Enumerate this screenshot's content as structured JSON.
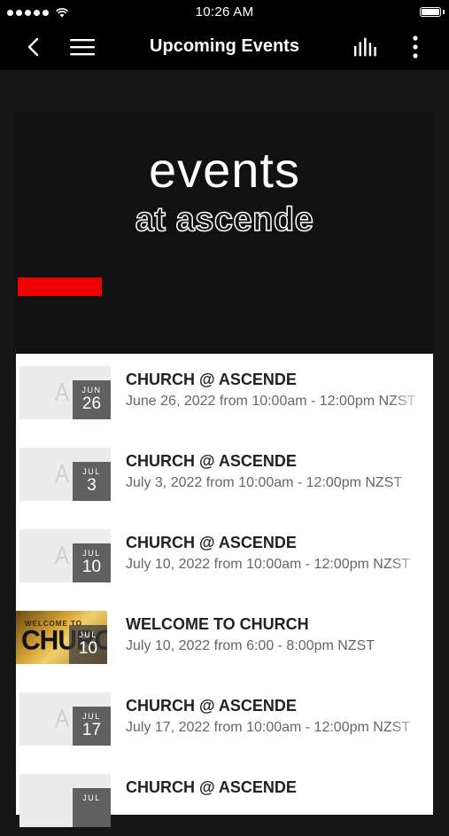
{
  "status": {
    "time": "10:26 AM",
    "signal_icon": "signal-dots-icon",
    "wifi_icon": "wifi-icon",
    "battery_icon": "battery-icon"
  },
  "nav": {
    "title": "Upcoming Events",
    "back_icon": "chevron-left-icon",
    "menu_icon": "hamburger-menu-icon",
    "stats_icon": "equalizer-icon",
    "more_icon": "vertical-dots-icon"
  },
  "banner": {
    "title": "events",
    "subtitle": "at ascende",
    "accent_color": "#f10000"
  },
  "events": [
    {
      "title": "CHURCH @ ASCENDE",
      "time": "June 26, 2022 from 10:00am - 12:00pm NZST",
      "month": "JUN",
      "day": "26",
      "thumb": "logo"
    },
    {
      "title": "CHURCH @ ASCENDE",
      "time": "July 3, 2022 from 10:00am - 12:00pm NZST",
      "month": "JUL",
      "day": "3",
      "thumb": "logo"
    },
    {
      "title": "CHURCH @ ASCENDE",
      "time": "July 10, 2022 from 10:00am - 12:00pm NZST",
      "month": "JUL",
      "day": "10",
      "thumb": "logo"
    },
    {
      "title": "WELCOME TO CHURCH",
      "time": "July 10, 2022 from 6:00 - 8:00pm NZST",
      "month": "JUL",
      "day": "10",
      "thumb": "welcome",
      "thumb_small": "WELCOME TO",
      "thumb_big": "CHURCH"
    },
    {
      "title": "CHURCH @ ASCENDE",
      "time": "July 17, 2022 from 10:00am - 12:00pm NZST",
      "month": "JUL",
      "day": "17",
      "thumb": "logo"
    },
    {
      "title": "CHURCH @ ASCENDE",
      "time": "",
      "month": "JUL",
      "day": "",
      "thumb": "logo"
    }
  ]
}
